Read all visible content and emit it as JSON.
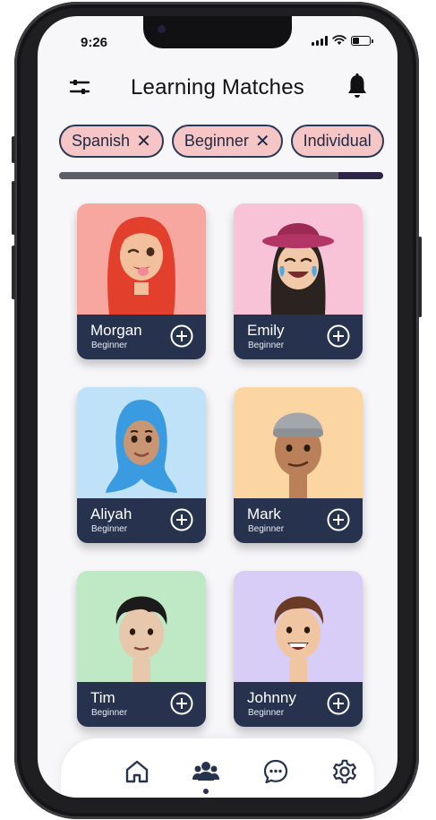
{
  "status_bar": {
    "time": "9:26"
  },
  "header": {
    "title": "Learning Matches"
  },
  "filters": [
    {
      "label": "Spanish",
      "remove": "✕"
    },
    {
      "label": "Beginner",
      "remove": "✕"
    },
    {
      "label": "Individual"
    }
  ],
  "progress": {
    "value": 0.86
  },
  "matches": [
    {
      "name": "Morgan",
      "level": "Beginner",
      "bg": "#f7a7a0"
    },
    {
      "name": "Emily",
      "level": "Beginner",
      "bg": "#f8c3d7"
    },
    {
      "name": "Aliyah",
      "level": "Beginner",
      "bg": "#bfe2f8"
    },
    {
      "name": "Mark",
      "level": "Beginner",
      "bg": "#fbd6a3"
    },
    {
      "name": "Tim",
      "level": "Beginner",
      "bg": "#bfe8c5"
    },
    {
      "name": "Johnny",
      "level": "Beginner",
      "bg": "#d8cdf6"
    }
  ],
  "tab_bar": {
    "items": [
      "home-icon",
      "people-icon",
      "chat-icon",
      "gear-icon"
    ],
    "active": "people-icon"
  },
  "colors": {
    "card_footer": "#27324f",
    "chip_fill": "#f6c6c7",
    "chip_border": "#2b3a57"
  }
}
